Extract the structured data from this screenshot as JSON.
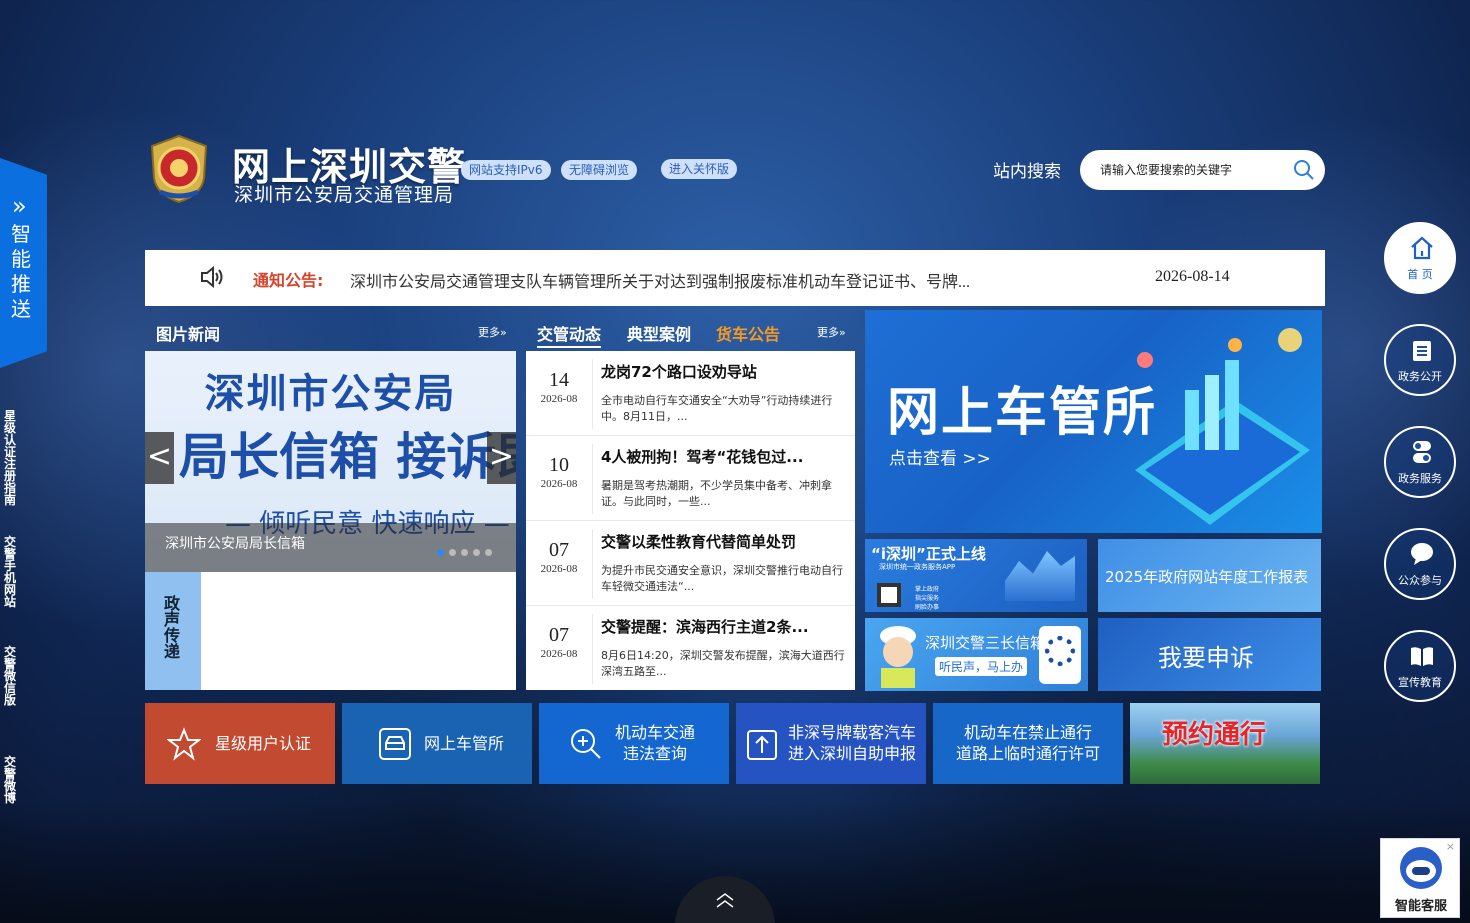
{
  "header": {
    "title": "网上深圳交警",
    "subtitle": "深圳市公安局交通管理局",
    "badges": [
      "网站支持IPv6",
      "无障碍浏览",
      "进入关怀版"
    ],
    "search_label": "站内搜索",
    "search_placeholder": "请输入您要搜索的关键字"
  },
  "notice": {
    "label": "通知公告:",
    "text": "深圳市公安局交通管理支队车辆管理所关于对达到强制报废标准机动车登记证书、号牌...",
    "date": "2026-08-14"
  },
  "left_rail": {
    "smart_push": "智能推送",
    "links": [
      "星级认证注册指南",
      "交警手机网站",
      "交警微信版",
      "交警微博"
    ]
  },
  "picture_news": {
    "title": "图片新闻",
    "more": "更多»",
    "slide_line1": "深圳市公安局",
    "slide_line2": "局长信箱 接诉即办",
    "slide_line3": "— 倾听民意 快速响应 —",
    "caption": "深圳市公安局局长信箱",
    "prev": "<",
    "next": ">"
  },
  "zhengsheng": {
    "label": "政声传递"
  },
  "traffic_tabs": {
    "tabs": [
      "交管动态",
      "典型案例",
      "货车公告"
    ],
    "more": "更多»",
    "items": [
      {
        "day": "14",
        "ym": "2026-08",
        "title": "龙岗72个路口设劝导站",
        "desc": "全市电动自行车交通安全“大劝导”行动持续进行中。8月11日，..."
      },
      {
        "day": "10",
        "ym": "2026-08",
        "title": "4人被刑拘！驾考“花钱包过...",
        "desc": "暑期是驾考热潮期，不少学员集中备考、冲刺拿证。与此同时，一些..."
      },
      {
        "day": "07",
        "ym": "2026-08",
        "title": "交警以柔性教育代替简单处罚",
        "desc": "为提升市民交通安全意识，深圳交警推行电动自行车轻微交通违法“..."
      },
      {
        "day": "07",
        "ym": "2026-08",
        "title": "交警提醒：滨海西行主道2条...",
        "desc": "8月6日14:20，深圳交警发布提醒，滨海大道西行深湾五路至..."
      }
    ]
  },
  "banners": {
    "main_title": "网上车管所",
    "main_link": "点击查看 >>",
    "tile1_title": "“i深圳”正式上线",
    "tile1_sub": "深圳市统一政务服务APP",
    "tile1_items": "掌上政府 指尖服务 刷脸办事",
    "tile2": "2025年政府网站年度工作报表",
    "tile3_title": "深圳交警三长信箱",
    "tile3_sub": "听民声，马上办",
    "tile4": "我要申诉"
  },
  "quick_buttons": [
    {
      "label": "星级用户认证",
      "color": "#c24a30"
    },
    {
      "label": "网上车管所",
      "color": "#1a63b3"
    },
    {
      "label1": "机动车交通",
      "label2": "违法查询",
      "color": "#1467d0"
    },
    {
      "label1": "非深号牌载客汽车",
      "label2": "进入深圳自助申报",
      "color": "#2554c2"
    },
    {
      "label1": "机动车在禁止通行",
      "label2": "道路上临时通行许可",
      "color": "#1767c9"
    },
    {
      "label": "预约通行",
      "color": "#3b7a3f"
    }
  ],
  "right_nav": [
    "首 页",
    "政务公开",
    "政务服务",
    "公众参与",
    "宣传教育"
  ],
  "kefu": {
    "label": "智能客服",
    "close": "×"
  }
}
